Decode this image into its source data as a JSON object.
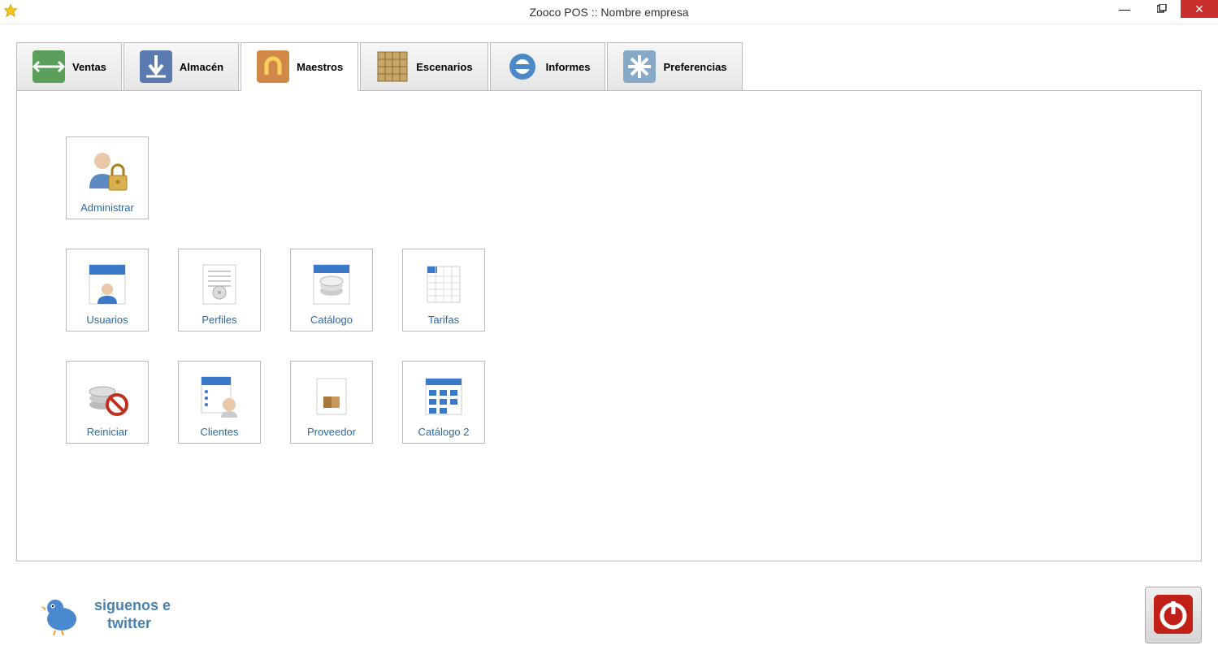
{
  "window": {
    "title": "Zooco POS :: Nombre empresa"
  },
  "tabs": [
    {
      "label": "Ventas"
    },
    {
      "label": "Almacén"
    },
    {
      "label": "Maestros"
    },
    {
      "label": "Escenarios"
    },
    {
      "label": "Informes"
    },
    {
      "label": "Preferencias"
    }
  ],
  "cards": {
    "row1": [
      {
        "label": "Administrar"
      }
    ],
    "row2": [
      {
        "label": "Usuarios"
      },
      {
        "label": "Perfiles"
      },
      {
        "label": "Catálogo"
      },
      {
        "label": "Tarifas"
      }
    ],
    "row3": [
      {
        "label": "Reiniciar"
      },
      {
        "label": "Clientes"
      },
      {
        "label": "Proveedor"
      },
      {
        "label": "Catálogo 2"
      }
    ]
  },
  "footer": {
    "twitter_line1": "siguenos e",
    "twitter_line2": "twitter"
  }
}
